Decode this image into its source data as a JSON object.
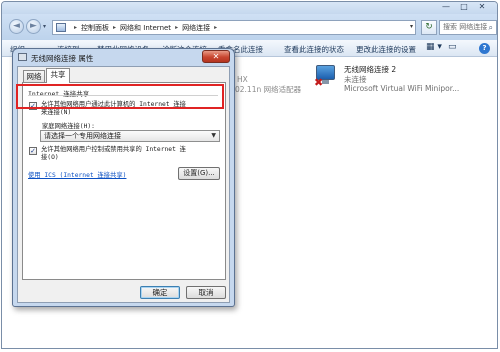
{
  "window": {
    "controls": {
      "minimize": "—",
      "maximize": "□",
      "close": "✕"
    }
  },
  "address": {
    "back": "◄",
    "forward": "►",
    "history": "▾",
    "segments": [
      "控制面板",
      "网络和 Internet",
      "网络连接"
    ],
    "separator": "▸",
    "dropdown": "▾",
    "refresh": "↻",
    "search_placeholder": "搜索 网络连接",
    "search_icon": "search-icon"
  },
  "toolbar": {
    "organize": "组织 ▾",
    "connect": "连接到",
    "disable": "禁用此网络设备",
    "diagnose": "诊断这个连接",
    "rename": "重命名此连接",
    "status": "查看此连接的状态",
    "settings": "更改此连接的设置",
    "view": "▦ ▾",
    "pane": "▭",
    "help": "?"
  },
  "connections": {
    "hidden_name_fragment": "HX",
    "hidden_device_fragment": "02.11n 网络适配器",
    "conn2": {
      "name": "无线网络连接 2",
      "status": "未连接",
      "device": "Microsoft Virtual WiFi Minipor...",
      "error_mark": "✖"
    }
  },
  "dialog": {
    "title": "无线网络连接 属性",
    "close": "✕",
    "tabs": {
      "network": "网络",
      "sharing": "共享"
    },
    "section_title": "Internet 连接共享",
    "allow_connect": {
      "checked": true,
      "mark": "✓",
      "line1": "允许其他网络用户通过此计算机的 Internet 连接",
      "line2": "来连接(N)"
    },
    "home_network_label": "家庭网络连接(H):",
    "home_network_value": "请选择一个专用网络连接",
    "select_arrow": "▼",
    "allow_control": {
      "checked": true,
      "mark": "✓",
      "line1": "允许其他网络用户控制或禁用共享的 Internet 连",
      "line2": "接(O)"
    },
    "ics_link": "使用 ICS (Internet 连接共享)",
    "settings_button": "设置(G)...",
    "ok": "确定",
    "cancel": "取消"
  },
  "colors": {
    "highlight": "#e02424",
    "link": "#0a4fc2",
    "error": "#c21b1b"
  }
}
